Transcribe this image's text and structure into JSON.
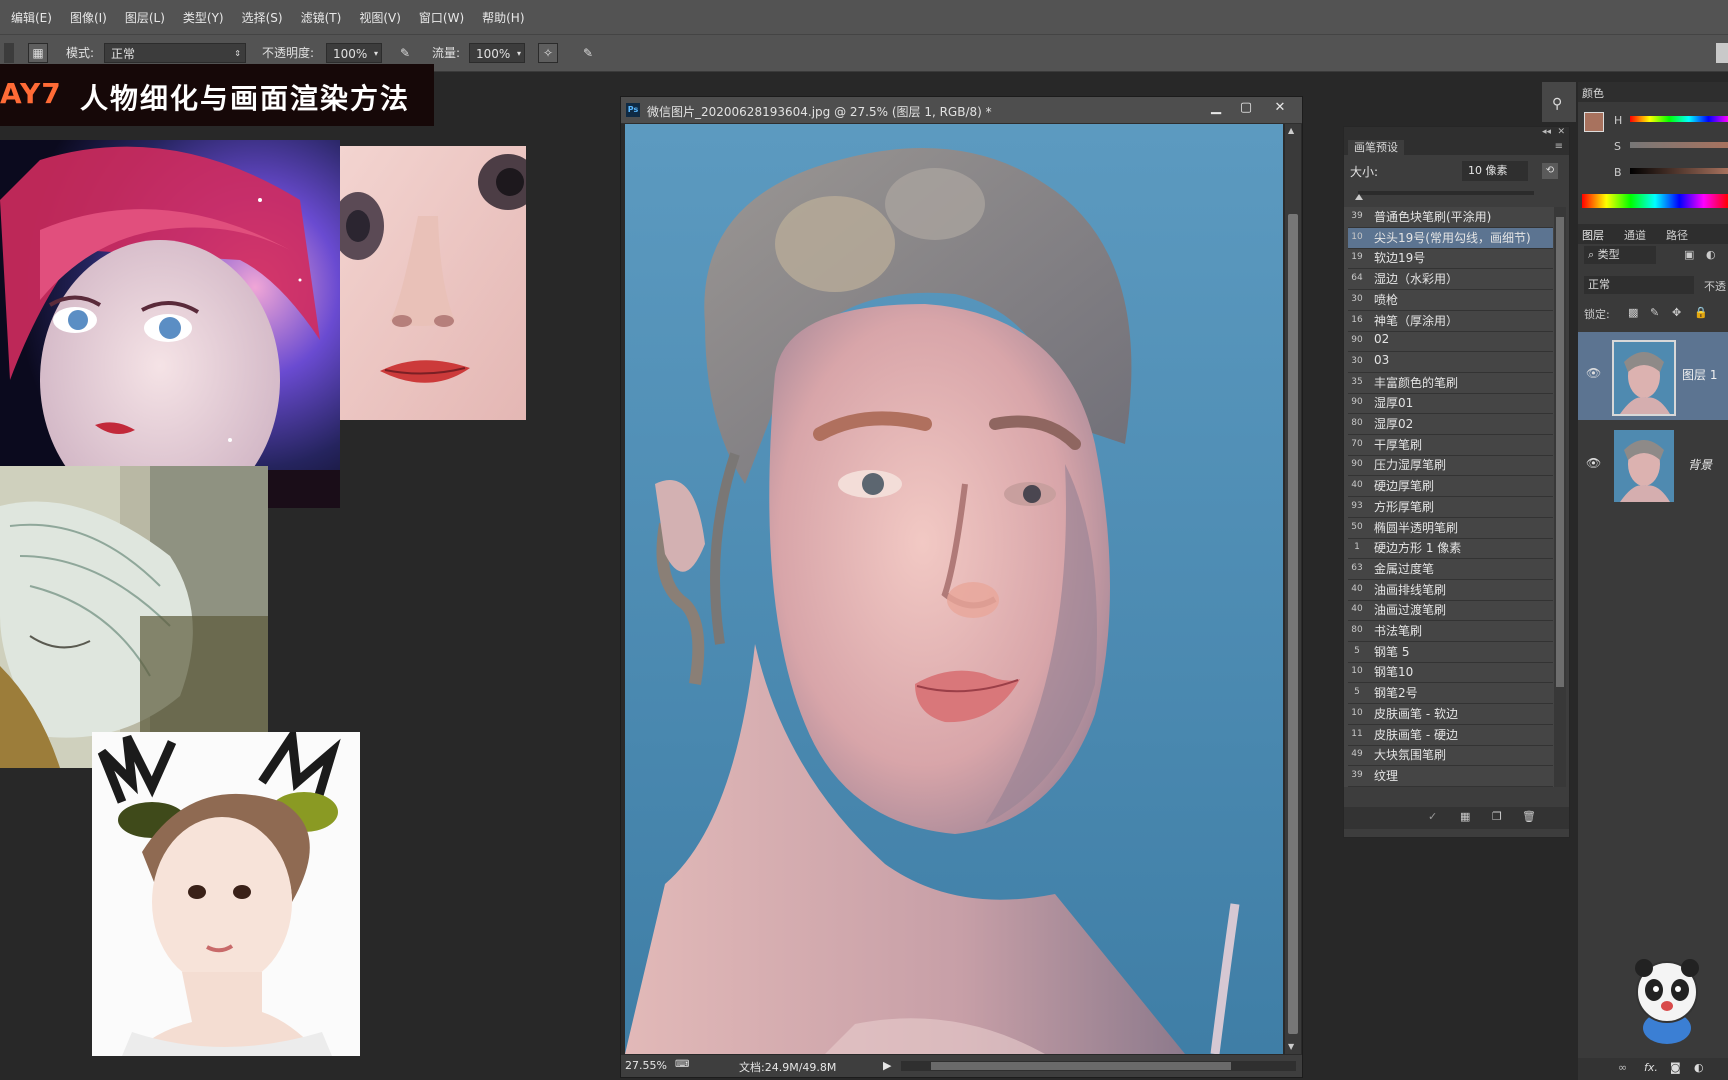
{
  "menu": [
    "编辑(E)",
    "图像(I)",
    "图层(L)",
    "类型(Y)",
    "选择(S)",
    "滤镜(T)",
    "视图(V)",
    "窗口(W)",
    "帮助(H)"
  ],
  "options": {
    "mode_label": "模式:",
    "mode_value": "正常",
    "opacity_label": "不透明度:",
    "opacity_value": "100%",
    "flow_label": "流量:",
    "flow_value": "100%"
  },
  "banner": {
    "day": "AY7",
    "title": "人物细化与画面渲染方法"
  },
  "document": {
    "title": "微信图片_20200628193604.jpg @ 27.5% (图层 1, RGB/8) *",
    "zoom": "27.55%",
    "doc_size": "文档:24.9M/49.8M"
  },
  "brush_panel": {
    "tab": "画笔预设",
    "size_label": "大小:",
    "size_value": "10 像素",
    "selected_index": 1,
    "items": [
      {
        "num": "39",
        "name": "普通色块笔刷(平涂用)"
      },
      {
        "num": "10",
        "name": "尖头19号(常用勾线，画细节)"
      },
      {
        "num": "19",
        "name": "软边19号"
      },
      {
        "num": "64",
        "name": "湿边（水彩用）"
      },
      {
        "num": "30",
        "name": "喷枪"
      },
      {
        "num": "16",
        "name": "神笔（厚涂用）"
      },
      {
        "num": "90",
        "name": "02"
      },
      {
        "num": "30",
        "name": "03"
      },
      {
        "num": "35",
        "name": "丰富颜色的笔刷"
      },
      {
        "num": "90",
        "name": "湿厚01"
      },
      {
        "num": "80",
        "name": "湿厚02"
      },
      {
        "num": "70",
        "name": "干厚笔刷"
      },
      {
        "num": "90",
        "name": "压力湿厚笔刷"
      },
      {
        "num": "40",
        "name": "硬边厚笔刷"
      },
      {
        "num": "93",
        "name": "方形厚笔刷"
      },
      {
        "num": "50",
        "name": "椭圆半透明笔刷"
      },
      {
        "num": "1",
        "name": "硬边方形 1 像素"
      },
      {
        "num": "63",
        "name": "金属过度笔"
      },
      {
        "num": "40",
        "name": "油画排线笔刷"
      },
      {
        "num": "40",
        "name": "油画过渡笔刷"
      },
      {
        "num": "80",
        "name": "书法笔刷"
      },
      {
        "num": "5",
        "name": "钢笔 5"
      },
      {
        "num": "10",
        "name": "钢笔10"
      },
      {
        "num": "5",
        "name": "钢笔2号"
      },
      {
        "num": "10",
        "name": "皮肤画笔 - 软边"
      },
      {
        "num": "11",
        "name": "皮肤画笔 - 硬边"
      },
      {
        "num": "49",
        "name": "大块氛围笔刷"
      },
      {
        "num": "39",
        "name": "纹理"
      }
    ]
  },
  "color_panel": {
    "tab": "颜色",
    "h": "H",
    "s": "S",
    "b": "B",
    "foreground": "#a8725e",
    "background": "#1d2fc8"
  },
  "layers_panel": {
    "tabs": [
      "图层",
      "通道",
      "路径"
    ],
    "filter_label": "类型",
    "blend_mode": "正常",
    "opacity_short": "不透",
    "lock_label": "锁定:",
    "layers": [
      {
        "name": "图层 1",
        "selected": true
      },
      {
        "name": "背景",
        "selected": false
      }
    ],
    "fx_label": "fx."
  },
  "colors": {
    "menubar": "#535353",
    "panel": "#3d3d3d",
    "selection": "#5c7491",
    "canvas_bg": "#4a86aa",
    "banner_accent": "#ff6b36"
  }
}
